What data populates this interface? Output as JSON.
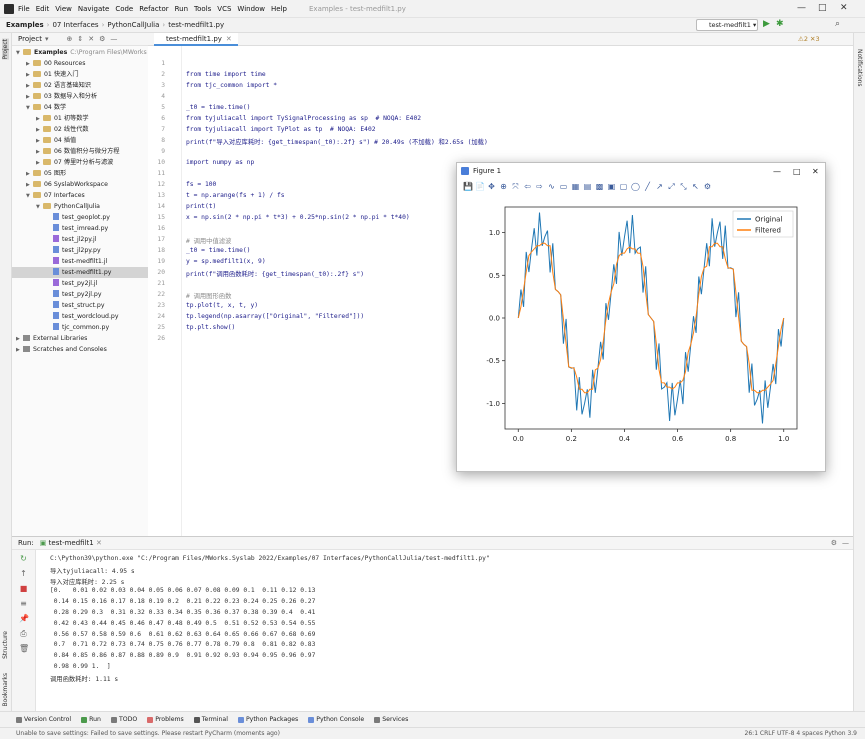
{
  "app": {
    "menu": [
      "File",
      "Edit",
      "View",
      "Navigate",
      "Code",
      "Refactor",
      "Run",
      "Tools",
      "VCS",
      "Window",
      "Help"
    ],
    "window_title": "Examples - test-medfilt1.py",
    "winctl": {
      "min": "—",
      "max": "□",
      "close": "✕"
    }
  },
  "nav": {
    "crumbs": [
      "Examples",
      "07 Interfaces",
      "PythonCallJulia",
      "test-medfilt1.py"
    ],
    "run_config": "test-medfilt1"
  },
  "left_toolbar": {
    "project": "Project",
    "structure": "Structure",
    "bookmarks": "Bookmarks"
  },
  "right_toolbar": {
    "notifications": "Notifications"
  },
  "project": {
    "header": "Project",
    "tree": [
      {
        "label": "Examples",
        "extra": "C:\\Program Files\\MWorks",
        "depth": 0,
        "kind": "folder",
        "open": true
      },
      {
        "label": "00 Resources",
        "depth": 1,
        "kind": "folder"
      },
      {
        "label": "01 快速入门",
        "depth": 1,
        "kind": "folder"
      },
      {
        "label": "02 语言基础知识",
        "depth": 1,
        "kind": "folder"
      },
      {
        "label": "03 数据导入和分析",
        "depth": 1,
        "kind": "folder"
      },
      {
        "label": "04 数学",
        "depth": 1,
        "kind": "folder",
        "open": true
      },
      {
        "label": "01 初等数学",
        "depth": 2,
        "kind": "folder"
      },
      {
        "label": "02 线性代数",
        "depth": 2,
        "kind": "folder"
      },
      {
        "label": "04 插值",
        "depth": 2,
        "kind": "folder"
      },
      {
        "label": "06 数值积分与微分方程",
        "depth": 2,
        "kind": "folder"
      },
      {
        "label": "07 傅里叶分析与滤波",
        "depth": 2,
        "kind": "folder"
      },
      {
        "label": "05 图形",
        "depth": 1,
        "kind": "folder"
      },
      {
        "label": "06 SyslabWorkspace",
        "depth": 1,
        "kind": "folder"
      },
      {
        "label": "07 Interfaces",
        "depth": 1,
        "kind": "folder",
        "open": true
      },
      {
        "label": "PythonCallJulia",
        "depth": 2,
        "kind": "folder",
        "open": true
      },
      {
        "label": "test_geoplot.py",
        "depth": 3,
        "kind": "py"
      },
      {
        "label": "test_imread.py",
        "depth": 3,
        "kind": "py"
      },
      {
        "label": "test_jl2py.jl",
        "depth": 3,
        "kind": "jl"
      },
      {
        "label": "test_jl2py.py",
        "depth": 3,
        "kind": "py"
      },
      {
        "label": "test-medfilt1.jl",
        "depth": 3,
        "kind": "jl"
      },
      {
        "label": "test-medfilt1.py",
        "depth": 3,
        "kind": "py",
        "selected": true
      },
      {
        "label": "test_py2jl.jl",
        "depth": 3,
        "kind": "jl"
      },
      {
        "label": "test_py2jl.py",
        "depth": 3,
        "kind": "py"
      },
      {
        "label": "test_struct.py",
        "depth": 3,
        "kind": "py"
      },
      {
        "label": "test_wordcloud.py",
        "depth": 3,
        "kind": "py"
      },
      {
        "label": "tjc_common.py",
        "depth": 3,
        "kind": "py"
      },
      {
        "label": "External Libraries",
        "depth": 0,
        "kind": "lib"
      },
      {
        "label": "Scratches and Consoles",
        "depth": 0,
        "kind": "lib"
      }
    ]
  },
  "editor": {
    "tab": "test-medfilt1.py",
    "inspections": "⚠2 ✕3",
    "lines": [
      {
        "n": "1",
        "t": ""
      },
      {
        "n": "2",
        "t": "from time import time"
      },
      {
        "n": "3",
        "t": "from tjc_common import *"
      },
      {
        "n": "4",
        "t": ""
      },
      {
        "n": "5",
        "t": "_t0 = time.time()"
      },
      {
        "n": "6",
        "t": "from tyjuliacall import TySignalProcessing as sp  # NOQA: E402"
      },
      {
        "n": "7",
        "t": "from tyjuliacall import TyPlot as tp  # NOQA: E402"
      },
      {
        "n": "8",
        "t": "print(f\"导入对应库耗时: {get_timespan(_t0):.2f} s\") # 20.49s (不加载) 和2.65s (加载)"
      },
      {
        "n": "9",
        "t": ""
      },
      {
        "n": "10",
        "t": "import numpy as np"
      },
      {
        "n": "11",
        "t": ""
      },
      {
        "n": "12",
        "t": "fs = 100"
      },
      {
        "n": "13",
        "t": "t = np.arange(fs + 1) / fs"
      },
      {
        "n": "14",
        "t": "print(t)"
      },
      {
        "n": "15",
        "t": "x = np.sin(2 * np.pi * t*3) + 0.25*np.sin(2 * np.pi * t*40)"
      },
      {
        "n": "16",
        "t": ""
      },
      {
        "n": "17",
        "t": "# 调用中值滤波"
      },
      {
        "n": "18",
        "t": "_t0 = time.time()"
      },
      {
        "n": "19",
        "t": "y = sp.medfilt1(x, 9)"
      },
      {
        "n": "20",
        "t": "print(f\"调用函数耗时: {get_timespan(_t0):.2f} s\")"
      },
      {
        "n": "21",
        "t": ""
      },
      {
        "n": "22",
        "t": "# 调用图形函数"
      },
      {
        "n": "23",
        "t": "tp.plot(t, x, t, y)"
      },
      {
        "n": "24",
        "t": "tp.legend(np.asarray([\"Original\", \"Filtered\"]))"
      },
      {
        "n": "25",
        "t": "tp.plt.show()"
      },
      {
        "n": "26",
        "t": ""
      }
    ]
  },
  "figure": {
    "title": "Figure 1",
    "min": "—",
    "max": "□",
    "close": "✕",
    "toolbar": [
      "💾",
      "📄",
      "✥",
      "⊕",
      "⤧",
      "⇦",
      "⇨",
      "∿",
      "▭",
      "▦",
      "▤",
      "▩",
      "▣",
      "▢",
      "◯",
      "╱",
      "↗",
      "⤢",
      "⤡",
      "↖",
      "⚙"
    ]
  },
  "chart_data": {
    "type": "line",
    "title": "",
    "xlabel": "",
    "ylabel": "",
    "xlim": [
      -0.05,
      1.05
    ],
    "ylim": [
      -1.3,
      1.3
    ],
    "xticks": [
      "0.0",
      "0.2",
      "0.4",
      "0.6",
      "0.8",
      "1.0"
    ],
    "yticks": [
      "1.0",
      "0.5",
      "0.0",
      "-0.5",
      "-1.0"
    ],
    "legend_position": "top-right",
    "series": [
      {
        "name": "Original",
        "color": "#1f77b4",
        "formula": "sin(2*pi*3*t)+0.25*sin(2*pi*40*t)",
        "points": 101
      },
      {
        "name": "Filtered",
        "color": "#ff7f0e",
        "formula": "medfilt1(x, 9)",
        "points": 101
      }
    ]
  },
  "run": {
    "label": "Run:",
    "tab": "test-medfilt1",
    "output": [
      "C:\\Python39\\python.exe \"C:/Program Files/MWorks.Syslab 2022/Examples/07 Interfaces/PythonCallJulia/test-medfilt1.py\"",
      "导入tyjuliacall: 4.95 s",
      "导入对应库耗时: 2.25 s",
      "[0.   0.01 0.02 0.03 0.04 0.05 0.06 0.07 0.08 0.09 0.1  0.11 0.12 0.13",
      " 0.14 0.15 0.16 0.17 0.18 0.19 0.2  0.21 0.22 0.23 0.24 0.25 0.26 0.27",
      " 0.28 0.29 0.3  0.31 0.32 0.33 0.34 0.35 0.36 0.37 0.38 0.39 0.4  0.41",
      " 0.42 0.43 0.44 0.45 0.46 0.47 0.48 0.49 0.5  0.51 0.52 0.53 0.54 0.55",
      " 0.56 0.57 0.58 0.59 0.6  0.61 0.62 0.63 0.64 0.65 0.66 0.67 0.68 0.69",
      " 0.7  0.71 0.72 0.73 0.74 0.75 0.76 0.77 0.78 0.79 0.8  0.81 0.82 0.83",
      " 0.84 0.85 0.86 0.87 0.88 0.89 0.9  0.91 0.92 0.93 0.94 0.95 0.96 0.97",
      " 0.98 0.99 1.  ]",
      "调用函数耗时: 1.11 s"
    ]
  },
  "bottom_tools": [
    {
      "label": "Version Control",
      "color": "#7a7a7a"
    },
    {
      "label": "Run",
      "color": "#4c9a4c"
    },
    {
      "label": "TODO",
      "color": "#7a7a7a"
    },
    {
      "label": "Problems",
      "color": "#d96a6a"
    },
    {
      "label": "Terminal",
      "color": "#555555"
    },
    {
      "label": "Python Packages",
      "color": "#6a8ed9"
    },
    {
      "label": "Python Console",
      "color": "#6a8ed9"
    },
    {
      "label": "Services",
      "color": "#7a7a7a"
    }
  ],
  "status": {
    "message": "Unable to save settings: Failed to save settings. Please restart PyCharm (moments ago)",
    "right": "26:1  CRLF  UTF-8  4 spaces  Python 3.9"
  }
}
